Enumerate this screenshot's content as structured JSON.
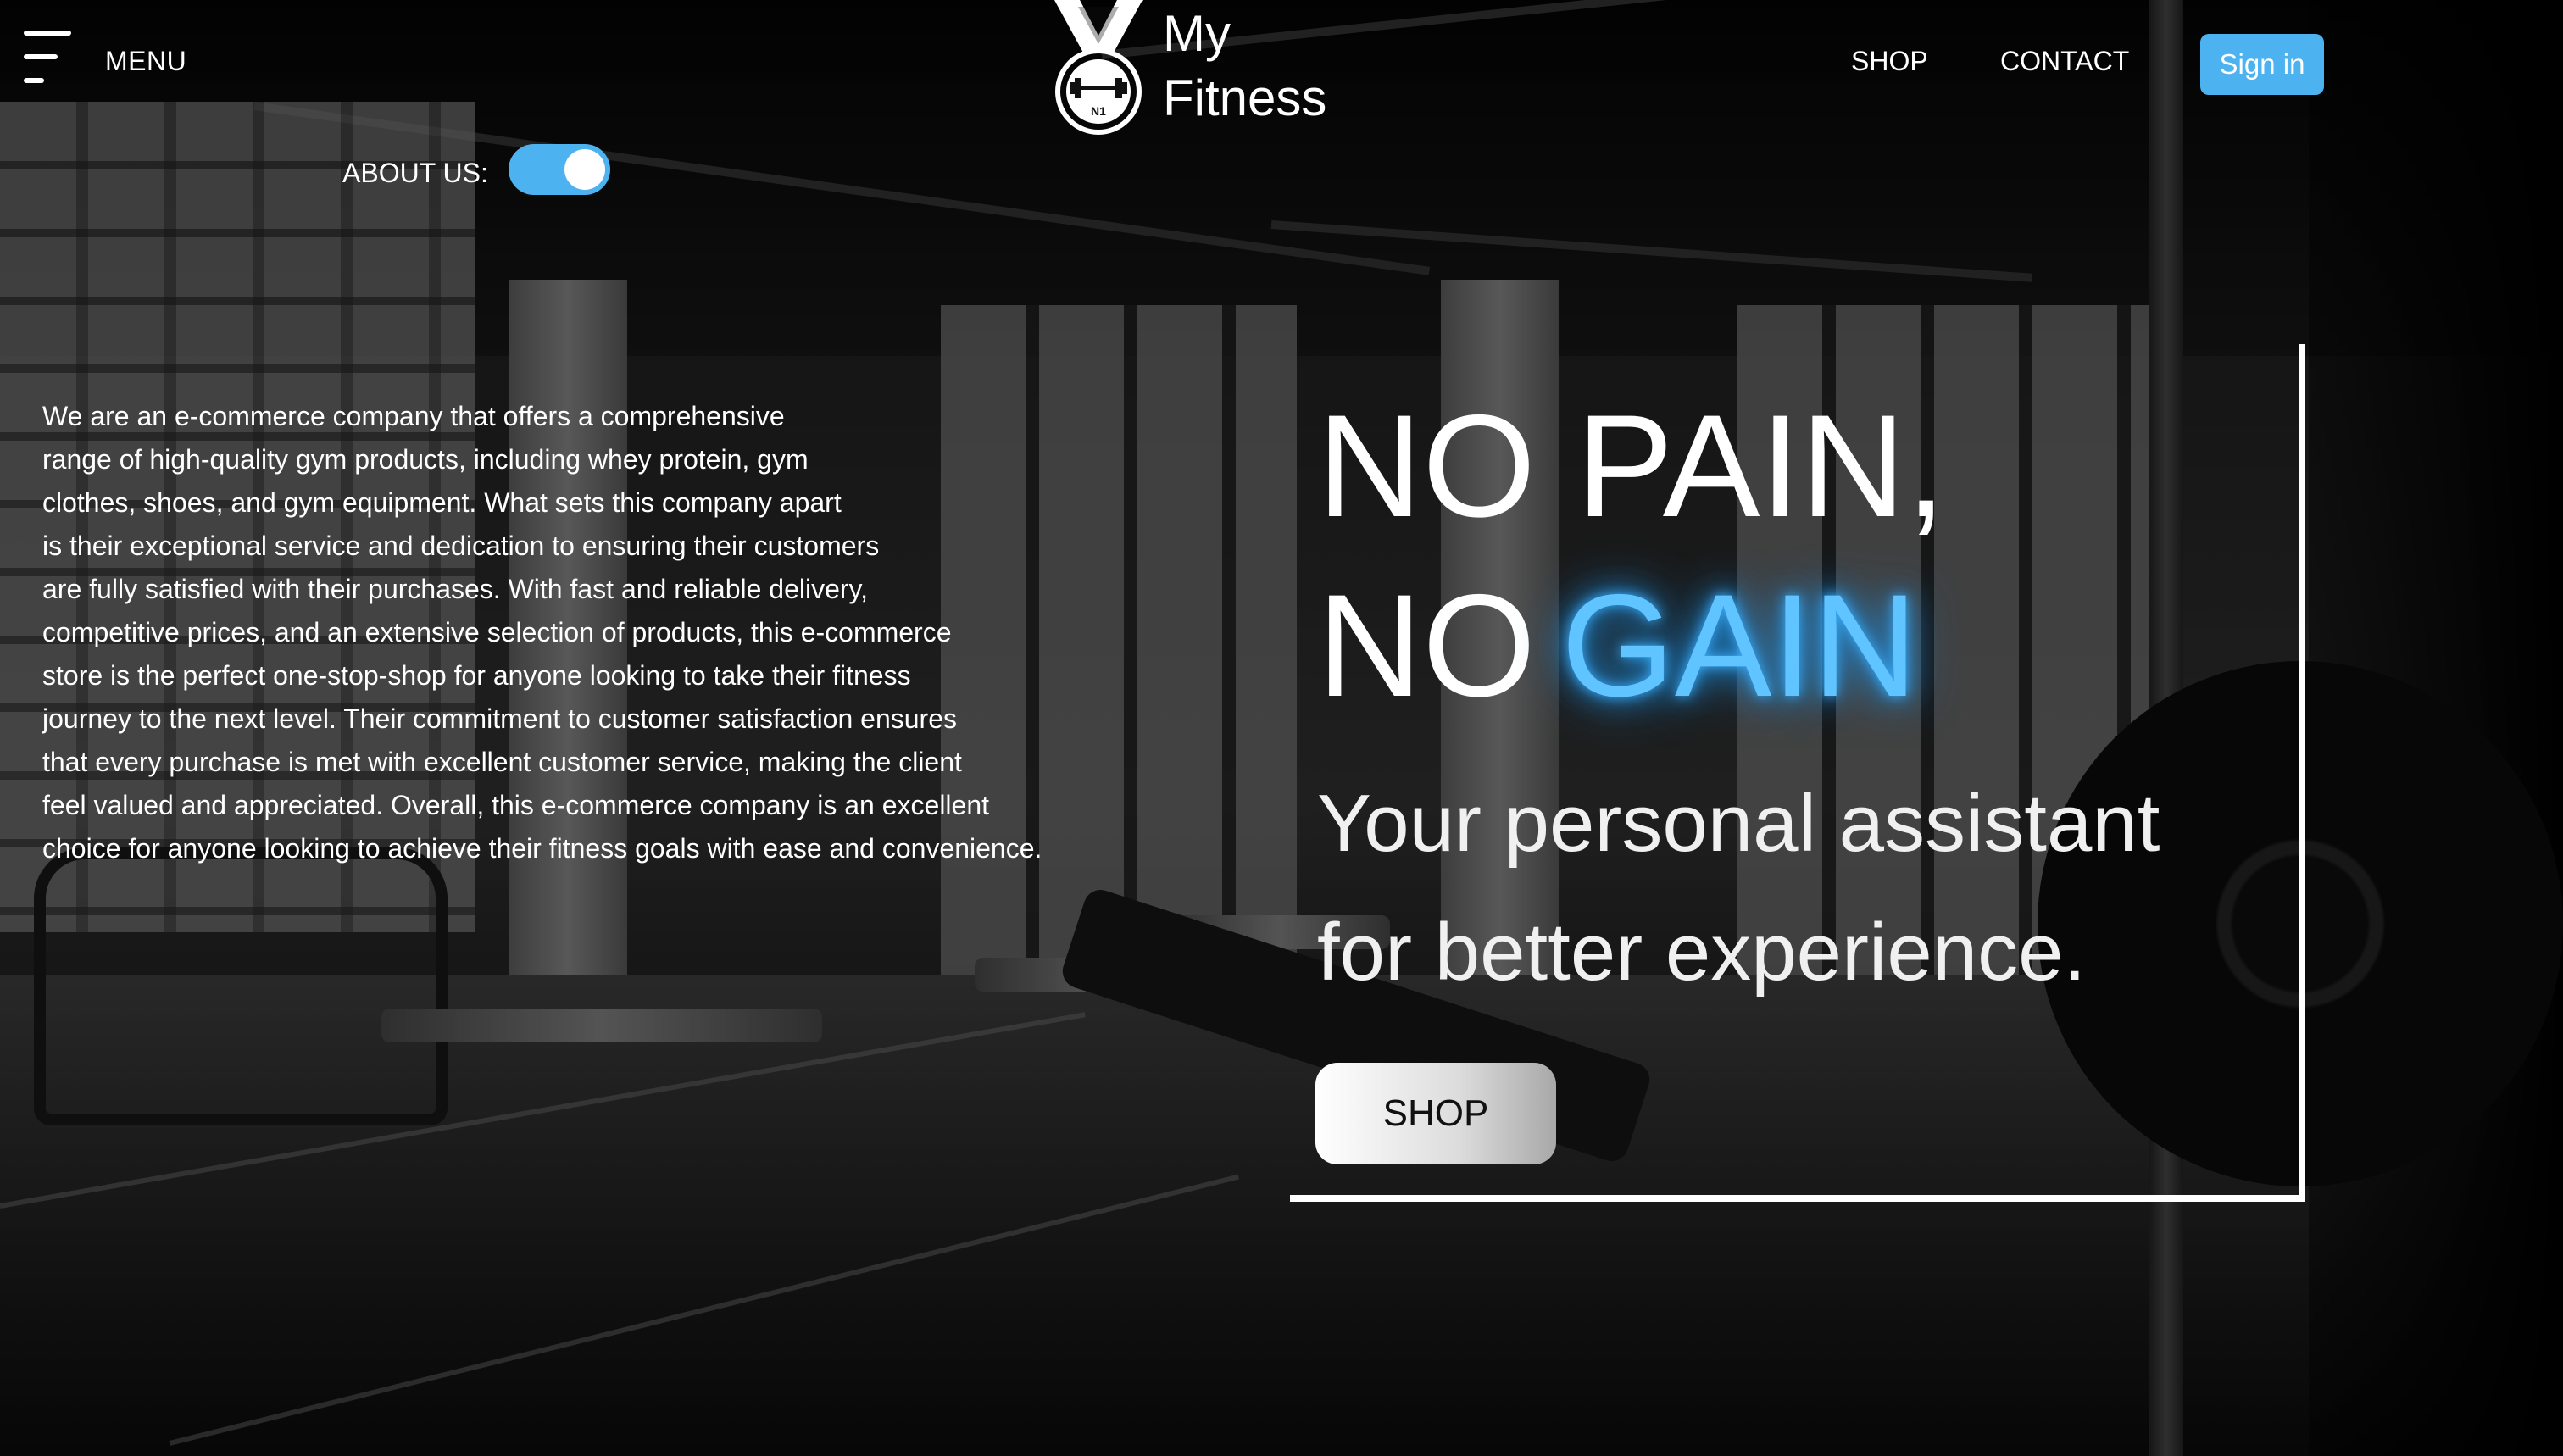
{
  "header": {
    "menu_label": "MENU",
    "brand_line1": "My",
    "brand_line2": "Fitness",
    "nav_shop": "SHOP",
    "nav_contact": "CONTACT",
    "sign_in": "Sign in"
  },
  "about": {
    "label": "ABOUT US:",
    "toggle_on": true,
    "lines": [
      "We are an e-commerce company that offers a comprehensive",
      "range of high-quality gym products, including whey protein, gym",
      "clothes, shoes, and gym equipment. What sets this company apart",
      "is their exceptional service and dedication to ensuring their customers",
      "are fully satisfied with their purchases. With fast and reliable delivery,",
      "competitive prices, and an extensive selection of products, this e-commerce",
      "store is the perfect one-stop-shop for anyone looking to take their fitness",
      "journey to the next level. Their commitment to customer satisfaction ensures",
      "that every purchase is met with excellent customer service, making the client",
      "feel valued and appreciated. Overall, this e-commerce company is an excellent",
      "choice for anyone looking to achieve their fitness goals with ease and convenience."
    ]
  },
  "hero": {
    "line1": "NO PAIN,",
    "line2_prefix": "NO",
    "line2_highlight": "GAIN",
    "tagline_line1": "Your personal assistant",
    "tagline_line2": "for better experience.",
    "cta": "SHOP"
  },
  "colors": {
    "accent": "#4db3f0",
    "glow": "#5fc4ff"
  },
  "icons": {
    "menu": "hamburger-icon",
    "logo": "medal-dumbbell-icon",
    "logo_badge_text": "N1"
  }
}
